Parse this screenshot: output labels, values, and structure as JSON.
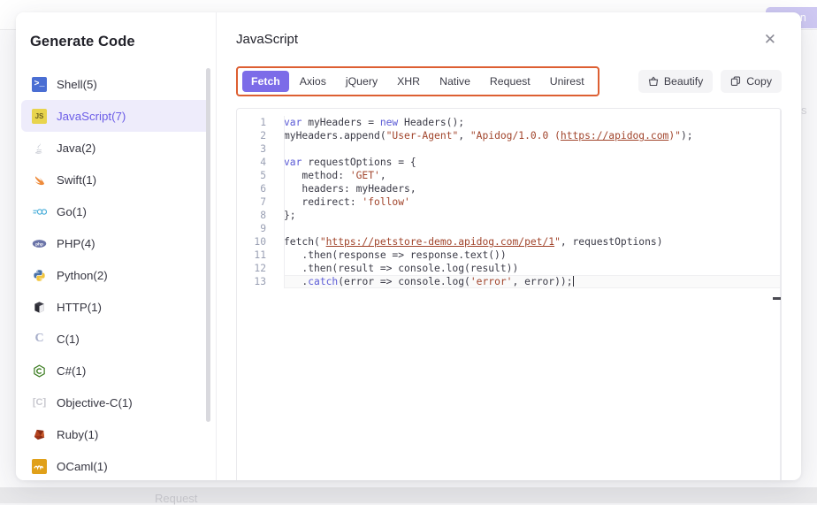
{
  "background": {
    "run_button_label": "Run",
    "apis_label": "APIs",
    "request_label": "Request"
  },
  "sidebar": {
    "title": "Generate Code",
    "items": [
      {
        "label": "Shell(5)",
        "icon": "shell-icon",
        "glyph": ">_",
        "active": false
      },
      {
        "label": "JavaScript(7)",
        "icon": "javascript-icon",
        "glyph": "JS",
        "active": true
      },
      {
        "label": "Java(2)",
        "icon": "java-icon",
        "glyph": "",
        "active": false
      },
      {
        "label": "Swift(1)",
        "icon": "swift-icon",
        "glyph": "↘",
        "active": false
      },
      {
        "label": "Go(1)",
        "icon": "go-icon",
        "glyph": "-oo",
        "active": false
      },
      {
        "label": "PHP(4)",
        "icon": "php-icon",
        "glyph": "◐",
        "active": false
      },
      {
        "label": "Python(2)",
        "icon": "python-icon",
        "glyph": "",
        "active": false
      },
      {
        "label": "HTTP(1)",
        "icon": "http-icon",
        "glyph": "",
        "active": false
      },
      {
        "label": "C(1)",
        "icon": "c-icon",
        "glyph": "C",
        "active": false
      },
      {
        "label": "C#(1)",
        "icon": "csharp-icon",
        "glyph": "⬡",
        "active": false
      },
      {
        "label": "Objective-C(1)",
        "icon": "objective-c-icon",
        "glyph": "[C]",
        "active": false
      },
      {
        "label": "Ruby(1)",
        "icon": "ruby-icon",
        "glyph": "",
        "active": false
      },
      {
        "label": "OCaml(1)",
        "icon": "ocaml-icon",
        "glyph": "∿",
        "active": false
      }
    ]
  },
  "content": {
    "title": "JavaScript",
    "close_label": "✕",
    "tabs": [
      {
        "label": "Fetch",
        "active": true
      },
      {
        "label": "Axios",
        "active": false
      },
      {
        "label": "jQuery",
        "active": false
      },
      {
        "label": "XHR",
        "active": false
      },
      {
        "label": "Native",
        "active": false
      },
      {
        "label": "Request",
        "active": false
      },
      {
        "label": "Unirest",
        "active": false
      }
    ],
    "buttons": {
      "beautify_label": "Beautify",
      "copy_label": "Copy"
    }
  },
  "code": {
    "language": "javascript",
    "line_numbers": [
      1,
      2,
      3,
      4,
      5,
      6,
      7,
      8,
      9,
      10,
      11,
      12,
      13
    ],
    "cursor_line": 13,
    "lines": [
      "var myHeaders = new Headers();",
      "myHeaders.append(\"User-Agent\", \"Apidog/1.0.0 (https://apidog.com)\");",
      "",
      "var requestOptions = {",
      "   method: 'GET',",
      "   headers: myHeaders,",
      "   redirect: 'follow'",
      "};",
      "",
      "fetch(\"https://petstore-demo.apidog.com/pet/1\", requestOptions)",
      "   .then(response => response.text())",
      "   .then(result => console.log(result))",
      "   .catch(error => console.log('error', error));"
    ]
  },
  "colors": {
    "accent": "#7c6ce8",
    "tabs_outline": "#dd5f32",
    "active_item_bg": "#eeecfb",
    "keyword": "#5b5bd6",
    "string": "#a1442b"
  }
}
